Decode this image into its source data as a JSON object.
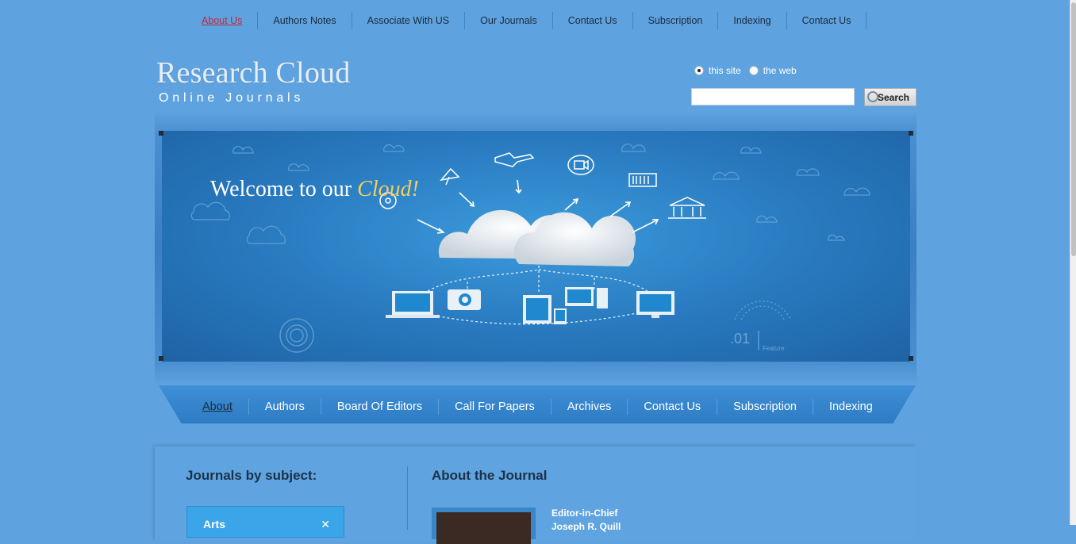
{
  "top_nav": [
    "About Us",
    "Authors Notes",
    "Associate With US",
    "Our Journals",
    "Contact Us",
    "Subscription",
    "Indexing",
    "Contact Us"
  ],
  "logo": {
    "title": "Research Cloud",
    "subtitle": "Online Journals"
  },
  "search": {
    "option1": "this site",
    "option2": "the web",
    "button": "Search",
    "query": ""
  },
  "banner": {
    "welcome": "Welcome to our",
    "welcome_accent": "Cloud!",
    "feature_number": ".01",
    "feature_label": "Feature"
  },
  "sub_nav": [
    "About",
    "Authors",
    "Board Of Editors",
    "Call For Papers",
    "Archives",
    "Contact Us",
    "Subscription",
    "Indexing"
  ],
  "sidebar": {
    "title": "Journals by subject:",
    "subject": "Arts",
    "toggle_icon": "close-x-icon"
  },
  "main": {
    "title": "About the Journal",
    "editor_label": "Editor-in-Chief",
    "editor_name": "Joseph R. Quill"
  },
  "colors": {
    "page_bg": "#5ea3df",
    "active_link": "#c0283a",
    "accent_gold": "#f3cf5e"
  }
}
